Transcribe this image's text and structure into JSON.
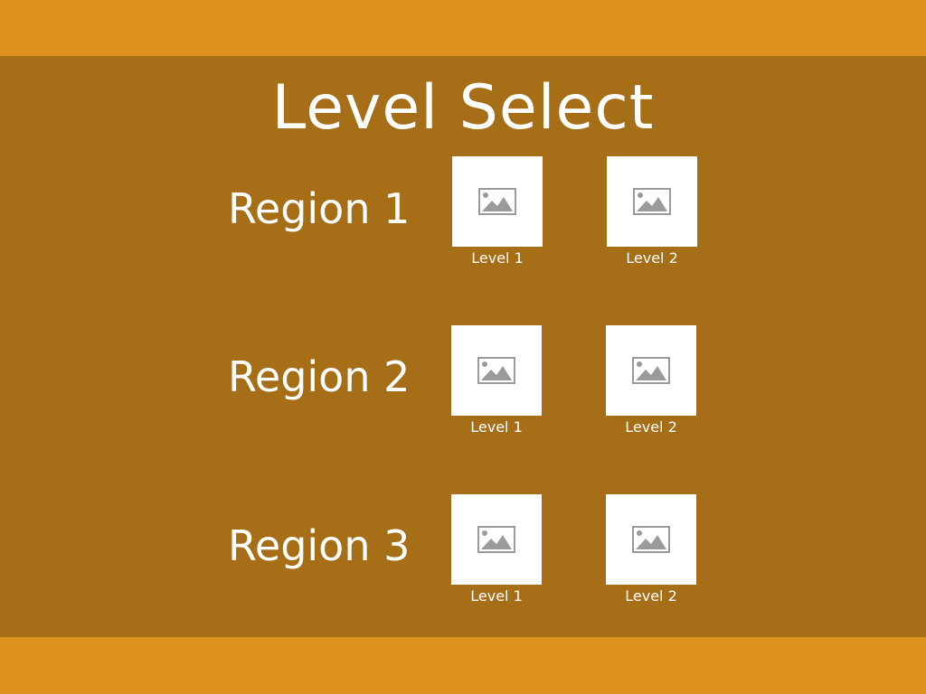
{
  "title": "Level Select",
  "colors": {
    "background": "#a66e17",
    "bars": "#de9220",
    "text": "#ffffff",
    "tile": "#ffffff",
    "placeholder_icon": "#9a9a9a"
  },
  "regions": [
    {
      "label": "Region 1",
      "levels": [
        {
          "label": "Level 1",
          "icon": "image-placeholder-icon"
        },
        {
          "label": "Level 2",
          "icon": "image-placeholder-icon"
        }
      ]
    },
    {
      "label": "Region 2",
      "levels": [
        {
          "label": "Level 1",
          "icon": "image-placeholder-icon"
        },
        {
          "label": "Level 2",
          "icon": "image-placeholder-icon"
        }
      ]
    },
    {
      "label": "Region 3",
      "levels": [
        {
          "label": "Level 1",
          "icon": "image-placeholder-icon"
        },
        {
          "label": "Level 2",
          "icon": "image-placeholder-icon"
        }
      ]
    }
  ]
}
